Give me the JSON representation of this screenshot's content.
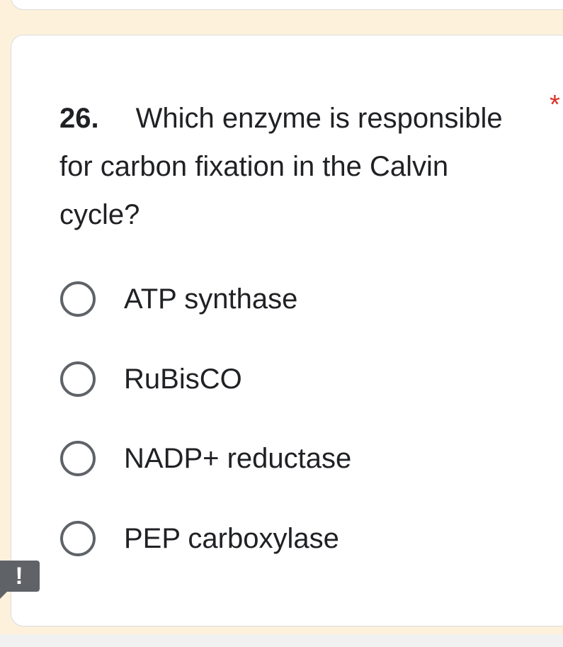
{
  "question": {
    "number": "26.",
    "text": "Which enzyme is responsible for carbon fixation in the Calvin cycle?",
    "required_marker": "*"
  },
  "options": [
    {
      "label": "ATP synthase",
      "selected": false
    },
    {
      "label": "RuBisCO",
      "selected": false
    },
    {
      "label": "NADP+ reductase",
      "selected": false
    },
    {
      "label": "PEP carboxylase",
      "selected": false
    }
  ],
  "alert_badge": {
    "text": "!",
    "icon": "exclamation-icon"
  },
  "colors": {
    "page_background": "#fdf1dc",
    "card_background": "#ffffff",
    "required_marker": "#d93025",
    "radio_border": "#5f6368",
    "badge_background": "#5f6368"
  }
}
